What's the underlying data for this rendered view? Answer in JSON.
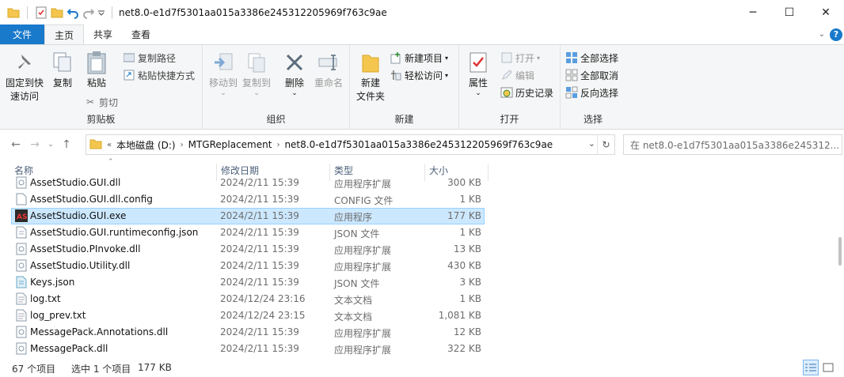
{
  "window": {
    "title": "net8.0-e1d7f5301aa015a3386e245312205969f763c9ae",
    "controls": {
      "minimize": "─",
      "maximize": "☐",
      "close": "✕"
    }
  },
  "tabs": [
    {
      "label": "文件"
    },
    {
      "label": "主页"
    },
    {
      "label": "共享"
    },
    {
      "label": "查看"
    }
  ],
  "ribbon": {
    "clipboard": {
      "label": "剪贴板",
      "pin_line1": "固定到快",
      "pin_line2": "速访问",
      "copy": "复制",
      "paste": "粘贴",
      "copy_path": "复制路径",
      "paste_shortcut": "粘贴快捷方式",
      "cut": "剪切"
    },
    "organize": {
      "label": "组织",
      "move_to": "移动到",
      "copy_to": "复制到",
      "delete": "删除",
      "rename": "重命名"
    },
    "new": {
      "label": "新建",
      "new_folder_line1": "新建",
      "new_folder_line2": "文件夹",
      "new_item": "新建项目",
      "easy_access": "轻松访问"
    },
    "open": {
      "label": "打开",
      "properties": "属性",
      "open": "打开",
      "edit": "编辑",
      "history": "历史记录"
    },
    "select": {
      "label": "选择",
      "select_all": "全部选择",
      "select_none": "全部取消",
      "invert": "反向选择"
    }
  },
  "address": {
    "crumbs": [
      "本地磁盘 (D:)",
      "MTGReplacement",
      "net8.0-e1d7f5301aa015a3386e245312205969f763c9ae"
    ],
    "search_placeholder": "在 net8.0-e1d7f5301aa015a3386e245312..."
  },
  "columns": {
    "name": "名称",
    "date": "修改日期",
    "type": "类型",
    "size": "大小"
  },
  "files": [
    {
      "name": "AssetStudio.GUI.dll",
      "date": "2024/2/11 15:39",
      "type": "应用程序扩展",
      "size": "300 KB",
      "icon": "dll-icon"
    },
    {
      "name": "AssetStudio.GUI.dll.config",
      "date": "2024/2/11 15:39",
      "type": "CONFIG 文件",
      "size": "1 KB",
      "icon": "file-icon"
    },
    {
      "name": "AssetStudio.GUI.exe",
      "date": "2024/2/11 15:39",
      "type": "应用程序",
      "size": "177 KB",
      "icon": "exe-icon",
      "selected": true
    },
    {
      "name": "AssetStudio.GUI.runtimeconfig.json",
      "date": "2024/2/11 15:39",
      "type": "JSON 文件",
      "size": "1 KB",
      "icon": "json-icon"
    },
    {
      "name": "AssetStudio.PInvoke.dll",
      "date": "2024/2/11 15:39",
      "type": "应用程序扩展",
      "size": "13 KB",
      "icon": "dll-icon"
    },
    {
      "name": "AssetStudio.Utility.dll",
      "date": "2024/2/11 15:39",
      "type": "应用程序扩展",
      "size": "430 KB",
      "icon": "dll-icon"
    },
    {
      "name": "Keys.json",
      "date": "2024/2/11 15:39",
      "type": "JSON 文件",
      "size": "3 KB",
      "icon": "json-icon"
    },
    {
      "name": "log.txt",
      "date": "2024/12/24 23:16",
      "type": "文本文档",
      "size": "1 KB",
      "icon": "txt-icon"
    },
    {
      "name": "log_prev.txt",
      "date": "2024/12/24 23:15",
      "type": "文本文档",
      "size": "1,081 KB",
      "icon": "txt-icon"
    },
    {
      "name": "MessagePack.Annotations.dll",
      "date": "2024/2/11 15:39",
      "type": "应用程序扩展",
      "size": "12 KB",
      "icon": "dll-icon"
    },
    {
      "name": "MessagePack.dll",
      "date": "2024/2/11 15:39",
      "type": "应用程序扩展",
      "size": "322 KB",
      "icon": "dll-icon"
    }
  ],
  "status": {
    "count": "67 个项目",
    "selection": "选中 1 个项目",
    "size": "177 KB"
  },
  "colors": {
    "accent": "#1979ca",
    "selection": "#cce8ff",
    "selection_border": "#99d1ff"
  }
}
